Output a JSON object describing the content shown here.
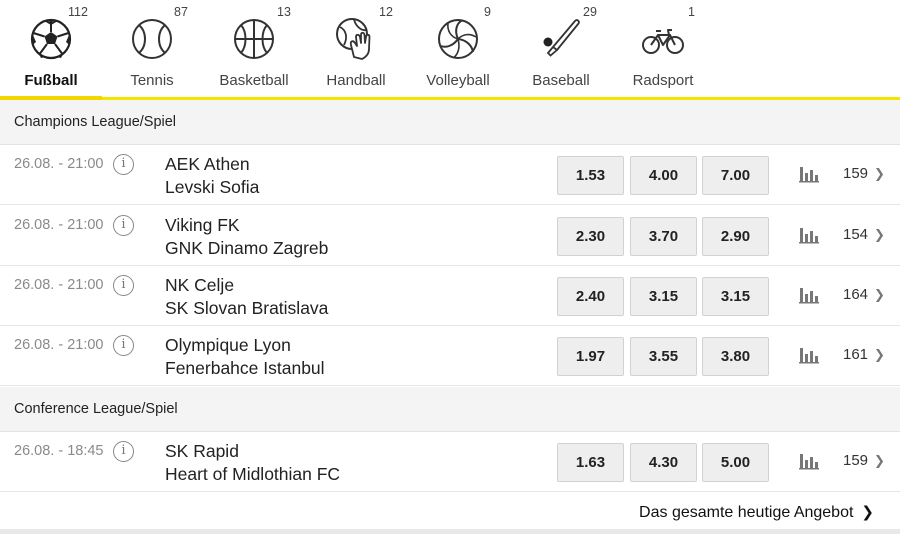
{
  "sports": [
    {
      "label": "Fußball",
      "count": "112",
      "icon": "soccer-ball-icon",
      "active": true
    },
    {
      "label": "Tennis",
      "count": "87",
      "icon": "tennis-ball-icon",
      "active": false
    },
    {
      "label": "Basketball",
      "count": "13",
      "icon": "basketball-icon",
      "active": false
    },
    {
      "label": "Handball",
      "count": "12",
      "icon": "handball-icon",
      "active": false
    },
    {
      "label": "Volleyball",
      "count": "9",
      "icon": "volleyball-icon",
      "active": false
    },
    {
      "label": "Baseball",
      "count": "29",
      "icon": "baseball-bat-icon",
      "active": false
    },
    {
      "label": "Radsport",
      "count": "1",
      "icon": "bicycle-icon",
      "active": false
    }
  ],
  "leagues": [
    {
      "name": "Champions League/Spiel",
      "matches": [
        {
          "time": "26.08. - 21:00",
          "home": "AEK Athen",
          "away": "Levski Sofia",
          "odds": [
            "1.53",
            "4.00",
            "7.00"
          ],
          "markets": "159"
        },
        {
          "time": "26.08. - 21:00",
          "home": "Viking FK",
          "away": "GNK Dinamo Zagreb",
          "odds": [
            "2.30",
            "3.70",
            "2.90"
          ],
          "markets": "154"
        },
        {
          "time": "26.08. - 21:00",
          "home": "NK Celje",
          "away": "SK Slovan Bratislava",
          "odds": [
            "2.40",
            "3.15",
            "3.15"
          ],
          "markets": "164"
        },
        {
          "time": "26.08. - 21:00",
          "home": "Olympique Lyon",
          "away": "Fenerbahce Istanbul",
          "odds": [
            "1.97",
            "3.55",
            "3.80"
          ],
          "markets": "161"
        }
      ]
    },
    {
      "name": "Conference League/Spiel",
      "matches": [
        {
          "time": "26.08. - 18:45",
          "home": "SK Rapid",
          "away": "Heart of Midlothian FC",
          "odds": [
            "1.63",
            "4.30",
            "5.00"
          ],
          "markets": "159"
        }
      ]
    }
  ],
  "footer": {
    "link_label": "Das gesamte heutige Angebot"
  },
  "colors": {
    "accent": "#f2d600",
    "odd_bg": "#eeeeee",
    "league_bg": "#f4f4f4"
  }
}
